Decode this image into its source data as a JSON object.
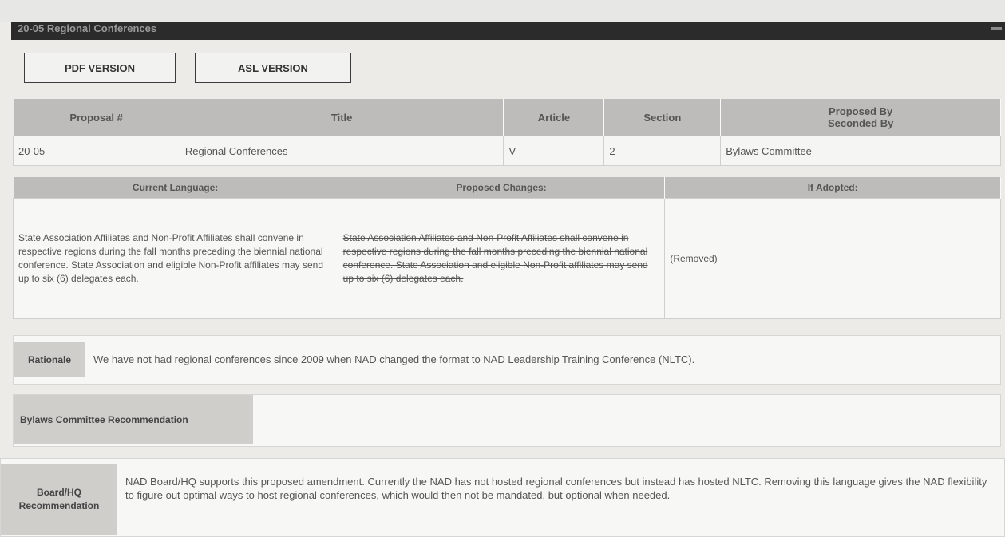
{
  "header": {
    "title": "20-05 Regional Conferences"
  },
  "buttons": {
    "pdf": "PDF VERSION",
    "asl": "ASL VERSION"
  },
  "proposal_table": {
    "headers": {
      "proposal": "Proposal #",
      "title": "Title",
      "article": "Article",
      "section": "Section",
      "proposed_by": "Proposed By",
      "seconded_by": "Seconded By"
    },
    "row": {
      "proposal": "20-05",
      "title": "Regional Conferences",
      "article": "V",
      "section": "2",
      "proposed_by": "Bylaws Committee"
    }
  },
  "language_table": {
    "headers": {
      "current": "Current Language:",
      "proposed": "Proposed Changes:",
      "adopted": "If Adopted:"
    },
    "current_text": "State Association Affiliates and Non-Profit Affiliates shall convene in respective regions during the fall months preceding the biennial national conference. State Association and eligible Non-Profit affiliates may send up to six (6) delegates each.",
    "proposed_text": "State Association Affiliates and Non-Profit Affiliates shall convene in respective regions during the fall months preceding the biennial national conference. State Association and eligible Non-Profit affiliates may send up to six (6) delegates each.",
    "adopted_text": "(Removed)"
  },
  "rationale": {
    "label": "Rationale",
    "text": "We have not had regional conferences since 2009 when NAD changed the format to NAD Leadership Training Conference (NLTC)."
  },
  "bylaws": {
    "label": "Bylaws Committee Recommendation",
    "text": ""
  },
  "board": {
    "label_line1": "Board/HQ",
    "label_line2": "Recommendation",
    "text": "NAD Board/HQ supports this proposed amendment. Currently the NAD has not hosted regional conferences but instead has hosted NLTC. Removing this language gives the NAD flexibility to figure out optimal ways to host regional conferences, which would then not be mandated, but optional when needed."
  }
}
